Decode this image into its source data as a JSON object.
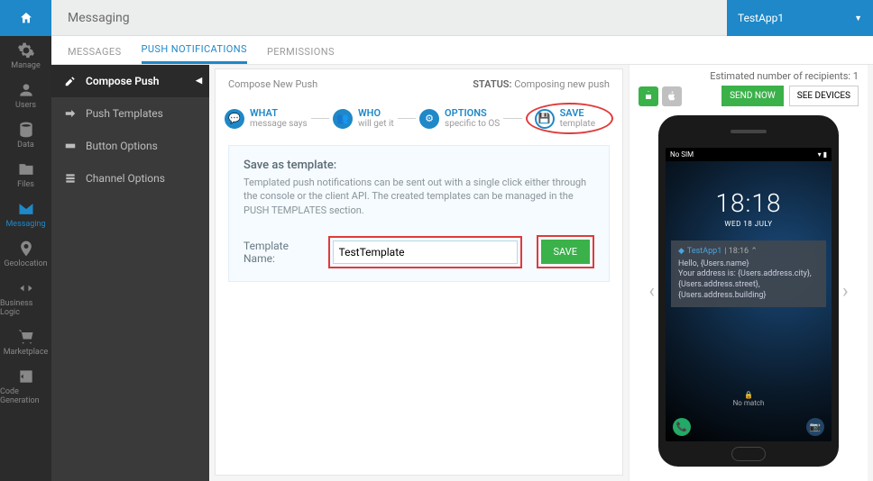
{
  "header": {
    "title": "Messaging"
  },
  "app_selector": {
    "name": "TestApp1"
  },
  "rail": [
    {
      "label": "Manage",
      "icon": "gear"
    },
    {
      "label": "Users",
      "icon": "users"
    },
    {
      "label": "Data",
      "icon": "db"
    },
    {
      "label": "Files",
      "icon": "folder"
    },
    {
      "label": "Messaging",
      "icon": "mail",
      "active": true
    },
    {
      "label": "Geolocation",
      "icon": "pin"
    },
    {
      "label": "Business Logic",
      "icon": "code"
    },
    {
      "label": "Marketplace",
      "icon": "cart"
    },
    {
      "label": "Code Generation",
      "icon": "codegen"
    }
  ],
  "tabs": [
    "MESSAGES",
    "PUSH NOTIFICATIONS",
    "PERMISSIONS"
  ],
  "active_tab": "PUSH NOTIFICATIONS",
  "sidenav": [
    {
      "label": "Compose Push",
      "active": true
    },
    {
      "label": "Push Templates"
    },
    {
      "label": "Button Options"
    },
    {
      "label": "Channel Options"
    }
  ],
  "canvas": {
    "breadcrumb": "Compose New Push",
    "status_label": "STATUS:",
    "status_value": "Composing new push"
  },
  "steps": [
    {
      "title": "WHAT",
      "sub": "message says"
    },
    {
      "title": "WHO",
      "sub": "will get it"
    },
    {
      "title": "OPTIONS",
      "sub": "specific to OS"
    },
    {
      "title": "SAVE",
      "sub": "template"
    }
  ],
  "panel": {
    "heading": "Save as template:",
    "desc": "Templated push notifications can be sent out with a single click either through the console or the client API. The created templates can be managed in the PUSH TEMPLATES section.",
    "field_label": "Template Name:",
    "field_value": "TestTemplate",
    "save_label": "SAVE"
  },
  "preview": {
    "recipients_label": "Estimated number of recipients: 1",
    "send_label": "SEND NOW",
    "devices_label": "SEE DEVICES",
    "phone": {
      "no_sim": "No SIM",
      "time": "18:18",
      "date": "WED 18 JULY",
      "notif_app": "TestApp1",
      "notif_time": "18:16",
      "notif_title": "Hello, {Users.name}",
      "notif_body": "Your address is: {Users.address.city}, {Users.address.street}, {Users.address.building}",
      "lock_label": "No match"
    }
  }
}
